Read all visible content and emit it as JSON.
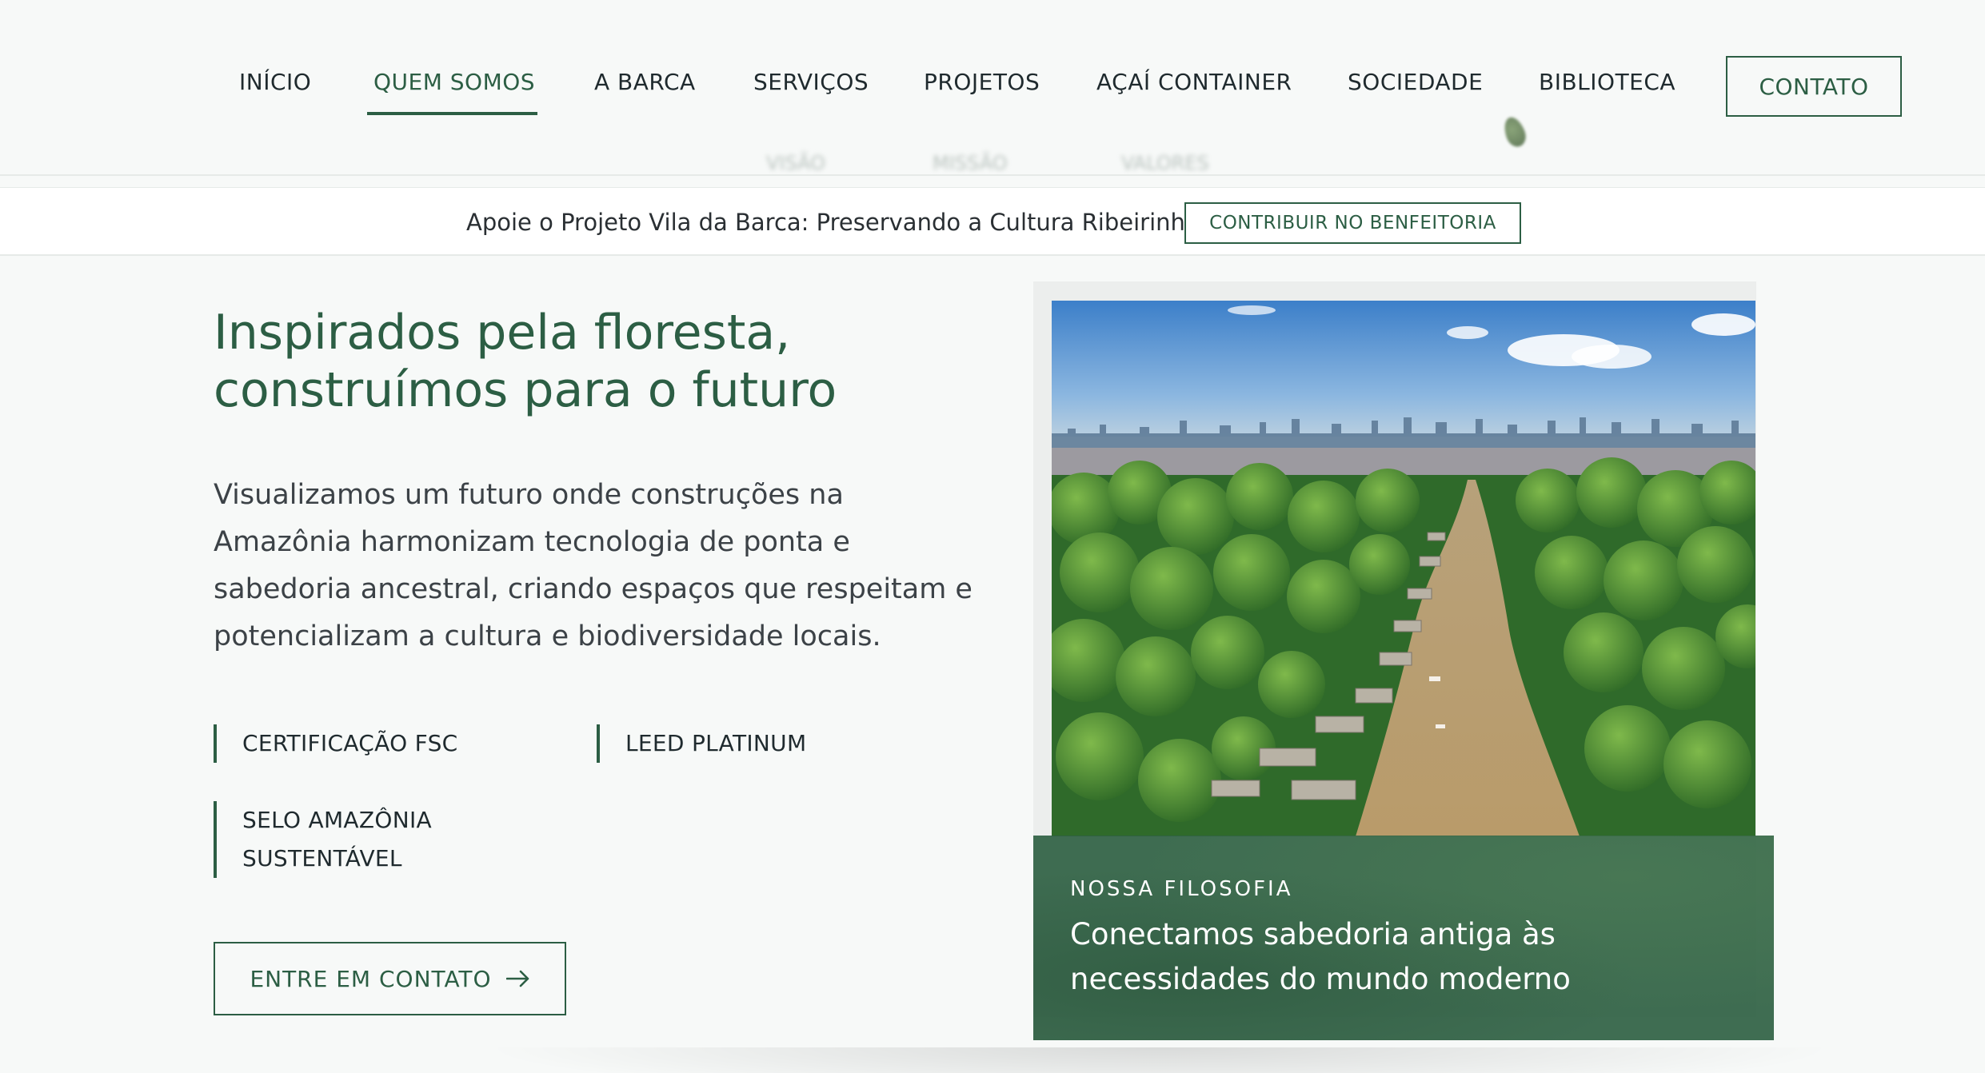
{
  "nav": {
    "items": [
      {
        "label": "INÍCIO"
      },
      {
        "label": "QUEM SOMOS"
      },
      {
        "label": "A BARCA"
      },
      {
        "label": "SERVIÇOS"
      },
      {
        "label": "PROJETOS"
      },
      {
        "label": "AÇAÍ CONTAINER"
      },
      {
        "label": "SOCIEDADE"
      },
      {
        "label": "BIBLIOTECA"
      }
    ],
    "active_label": "QUEM SOMOS",
    "contact_label": "CONTATO",
    "subnav": [
      "VISÃO",
      "MISSÃO",
      "VALORES"
    ]
  },
  "announcement": {
    "text": "Apoie o Projeto Vila da Barca: Preservando a Cultura Ribeirinha",
    "button_label": "CONTRIBUIR NO BENFEITORIA"
  },
  "hero": {
    "title_lines": [
      "Inspirados pela floresta,",
      "construímos para o futuro"
    ],
    "description_lines": [
      "Visualizamos um futuro onde construções na",
      "Amazônia harmonizam tecnologia de ponta e",
      "sabedoria ancestral, criando espaços que respeitam e",
      "potencializam a cultura e biodiversidade locais."
    ],
    "certifications": [
      {
        "lines": [
          "CERTIFICAÇÃO FSC"
        ]
      },
      {
        "lines": [
          "LEED PLATINUM"
        ]
      },
      {
        "lines": [
          "SELO AMAZÔNIA",
          "SUSTENTÁVEL"
        ]
      }
    ],
    "cta_label": "ENTRE EM CONTATO",
    "cta_icon": "arrow-right-icon"
  },
  "feature": {
    "image": "aerial-river-village-photo",
    "eyebrow": "NOSSA FILOSOFIA",
    "text_lines": [
      "Conectamos sabedoria antiga às",
      "necessidades do mundo moderno"
    ]
  },
  "colors": {
    "brand_green": "#2c5e44",
    "caption_bg": "#2f6143",
    "page_bg": "#f7f9f8"
  }
}
